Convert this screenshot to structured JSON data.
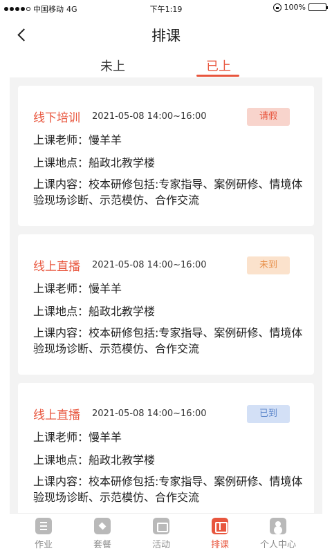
{
  "status_bar": {
    "carrier": "中国移动",
    "network": "4G",
    "time": "下午1:19",
    "battery": "100%"
  },
  "header": {
    "title": "排课"
  },
  "tabs": [
    {
      "label": "未上",
      "active": false
    },
    {
      "label": "已上",
      "active": true
    }
  ],
  "colors": {
    "accent": "#e8563e",
    "badge_leave_bg": "#f8d4cc",
    "badge_absent_bg": "#fbe2cc",
    "badge_present_bg": "#d3e0f6"
  },
  "cards": [
    {
      "type": "线下培训",
      "time": "2021-05-08 14:00~16:00",
      "status": "请假",
      "teacher": "上课老师：慢羊羊",
      "location": "上课地点：船政北教学楼",
      "content": "上课内容：校本研修包括:专家指导、案例研修、情境体验现场诊断、示范模仿、合作交流"
    },
    {
      "type": "线上直播",
      "time": "2021-05-08 14:00~16:00",
      "status": "未到",
      "teacher": "上课老师：慢羊羊",
      "location": "上课地点：船政北教学楼",
      "content": "上课内容：校本研修包括:专家指导、案例研修、情境体验现场诊断、示范模仿、合作交流"
    },
    {
      "type": "线上直播",
      "time": "2021-05-08 14:00~16:00",
      "status": "已到",
      "teacher": "上课老师：慢羊羊",
      "location": "上课地点：船政北教学楼",
      "content": "上课内容：校本研修包括:专家指导、案例研修、情境体验现场诊断、示范模仿、合作交流"
    }
  ],
  "bottom_nav": [
    {
      "label": "作业",
      "icon": "homework-icon",
      "active": false
    },
    {
      "label": "套餐",
      "icon": "package-icon",
      "active": false
    },
    {
      "label": "活动",
      "icon": "activity-icon",
      "active": false
    },
    {
      "label": "排课",
      "icon": "schedule-icon",
      "active": true
    },
    {
      "label": "个人中心",
      "icon": "profile-icon",
      "active": false
    }
  ]
}
